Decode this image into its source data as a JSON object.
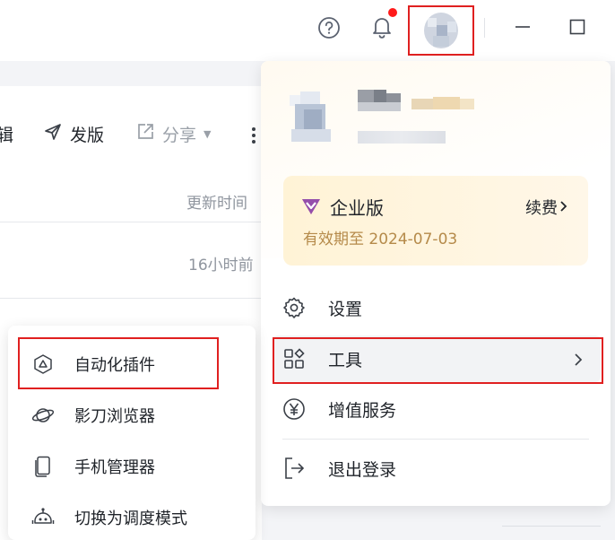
{
  "toolbar": {
    "partial_label": "辑",
    "publish_label": "发版",
    "share_label": "分享"
  },
  "table": {
    "header_updated": "更新时间",
    "row_updated": "16小时前"
  },
  "user_menu": {
    "plan": {
      "name": "企业版",
      "renew_label": "续费",
      "expiry": "有效期至 2024-07-03"
    },
    "items": [
      {
        "label": "设置",
        "icon": "gear-icon"
      },
      {
        "label": "工具",
        "icon": "apps-grid-icon"
      },
      {
        "label": "增值服务",
        "icon": "yuan-icon"
      },
      {
        "label": "退出登录",
        "icon": "logout-icon"
      }
    ]
  },
  "tools_submenu": {
    "items": [
      {
        "label": "自动化插件",
        "icon": "automation-icon"
      },
      {
        "label": "影刀浏览器",
        "icon": "planet-icon"
      },
      {
        "label": "手机管理器",
        "icon": "phone-icon"
      },
      {
        "label": "切换为调度模式",
        "icon": "robot-icon"
      }
    ]
  },
  "colors": {
    "highlight_border": "#e02020",
    "badge": "#ff1a1a",
    "enterprise_card_bg": "#fff3d6",
    "expiry_text": "#b58a4a"
  }
}
